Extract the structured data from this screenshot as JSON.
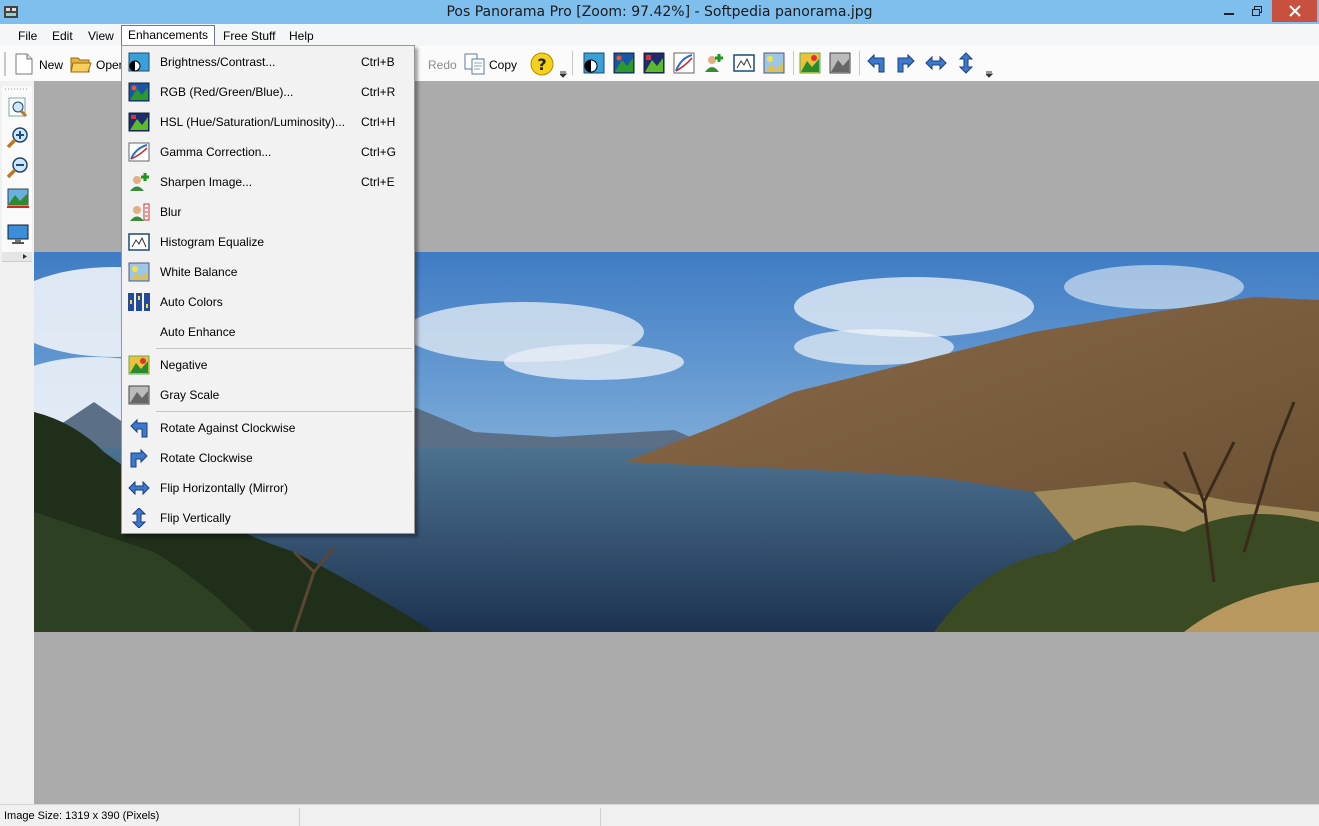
{
  "window": {
    "title": "Pos Panorama Pro [Zoom: 97.42%] - Softpedia panorama.jpg"
  },
  "menubar": {
    "items": [
      {
        "label": "File"
      },
      {
        "label": "Edit"
      },
      {
        "label": "View"
      },
      {
        "label": "Enhancements"
      },
      {
        "label": "Free Stuff"
      },
      {
        "label": "Help"
      }
    ]
  },
  "toolbar": {
    "new_label": "New",
    "open_label": "Open",
    "redo_label": "Redo",
    "copy_label": "Copy"
  },
  "enhancements_menu": {
    "items": [
      {
        "label": "Brightness/Contrast...",
        "shortcut": "Ctrl+B",
        "icon": "brightness-contrast-icon"
      },
      {
        "label": "RGB (Red/Green/Blue)...",
        "shortcut": "Ctrl+R",
        "icon": "rgb-icon"
      },
      {
        "label": "HSL (Hue/Saturation/Luminosity)...",
        "shortcut": "Ctrl+H",
        "icon": "hsl-icon"
      },
      {
        "label": "Gamma Correction...",
        "shortcut": "Ctrl+G",
        "icon": "gamma-icon"
      },
      {
        "label": "Sharpen Image...",
        "shortcut": "Ctrl+E",
        "icon": "sharpen-icon"
      },
      {
        "label": "Blur",
        "shortcut": "",
        "icon": "blur-icon"
      },
      {
        "label": "Histogram Equalize",
        "shortcut": "",
        "icon": "histogram-icon"
      },
      {
        "label": "White Balance",
        "shortcut": "",
        "icon": "white-balance-icon"
      },
      {
        "label": "Auto Colors",
        "shortcut": "",
        "icon": "auto-colors-icon"
      },
      {
        "label": "Auto Enhance",
        "shortcut": "",
        "icon": ""
      },
      {
        "label": "Negative",
        "shortcut": "",
        "icon": "negative-icon"
      },
      {
        "label": "Gray Scale",
        "shortcut": "",
        "icon": "grayscale-icon"
      },
      {
        "label": "Rotate Against Clockwise",
        "shortcut": "",
        "icon": "rotate-ccw-icon"
      },
      {
        "label": "Rotate Clockwise",
        "shortcut": "",
        "icon": "rotate-cw-icon"
      },
      {
        "label": "Flip Horizontally (Mirror)",
        "shortcut": "",
        "icon": "flip-horizontal-icon"
      },
      {
        "label": "Flip Vertically",
        "shortcut": "",
        "icon": "flip-vertical-icon"
      }
    ]
  },
  "status": {
    "image_size": "Image Size: 1319 x 390 (Pixels)"
  },
  "colors": {
    "titlebar": "#7fbfee",
    "workspace": "#ababab",
    "close_button": "#c7503f"
  }
}
